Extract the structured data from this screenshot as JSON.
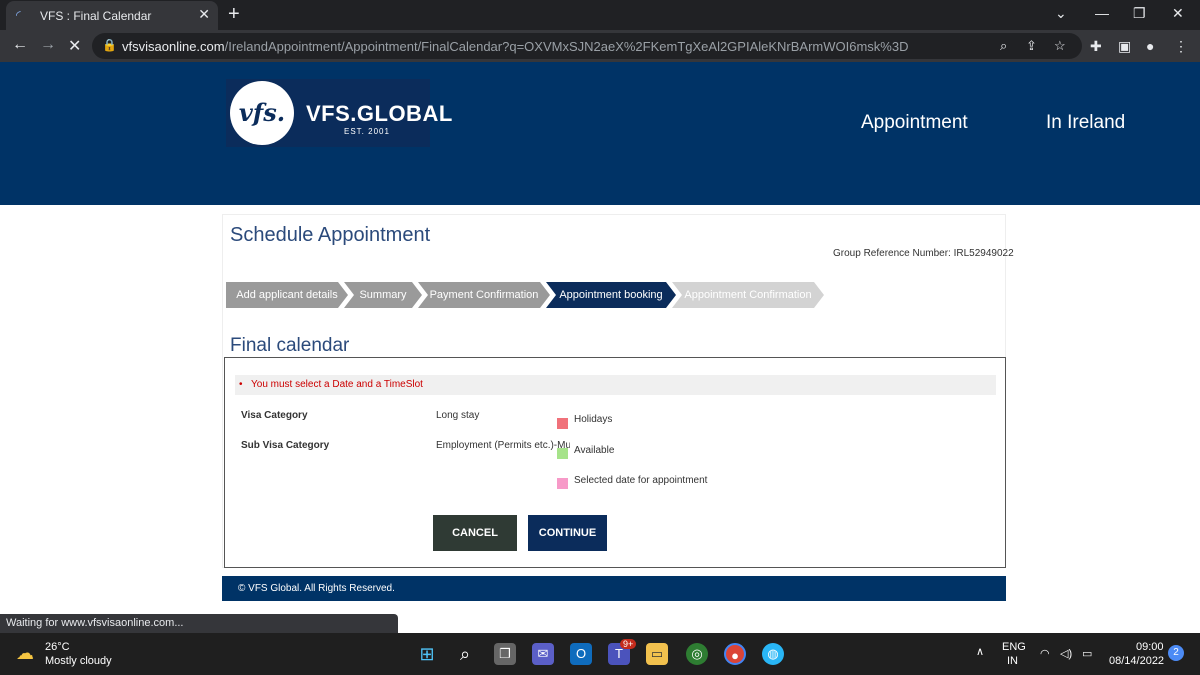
{
  "browser": {
    "tab_title": "VFS : Final Calendar",
    "url_host": "vfsvisaonline.com",
    "url_path": "/IrelandAppointment/Appointment/FinalCalendar?q=OXVMxSJN2aeX%2FKemTgXeAl2GPIAleKNrBArmWOI6msk%3D",
    "status_text": "Waiting for www.vfsvisaonline.com..."
  },
  "header": {
    "logo_mark": "vfs.",
    "logo_name": "VFS.GLOBAL",
    "logo_est": "EST. 2001",
    "nav": [
      "Appointment",
      "In Ireland"
    ],
    "bg_color": "#003366"
  },
  "page": {
    "title": "Schedule Appointment",
    "group_ref": "Group Reference Number: IRL52949022",
    "steps": [
      {
        "label": "Add applicant details",
        "state": "done"
      },
      {
        "label": "Summary",
        "state": "done"
      },
      {
        "label": "Payment Confirmation",
        "state": "done"
      },
      {
        "label": "Appointment booking",
        "state": "active"
      },
      {
        "label": "Appointment Confirmation",
        "state": "pending"
      }
    ],
    "section_title": "Final calendar",
    "error": "You must select a Date and a TimeSlot",
    "visa_category_label": "Visa Category",
    "visa_category_value": "Long stay",
    "sub_visa_label": "Sub Visa Category",
    "sub_visa_value": "Employment (Permits etc.)-Multi",
    "legend": [
      {
        "label": "Holidays",
        "color": "#f0717a"
      },
      {
        "label": "Available",
        "color": "#a6e38a"
      },
      {
        "label": "Selected date for appointment",
        "color": "#f79ac8"
      }
    ],
    "cancel_label": "CANCEL",
    "continue_label": "CONTINUE",
    "footer": "© VFS Global. All Rights Reserved."
  },
  "taskbar": {
    "weather_temp": "26°C",
    "weather_desc": "Mostly cloudy",
    "lang_top": "ENG",
    "lang_bottom": "IN",
    "time": "09:00",
    "date": "08/14/2022",
    "notif_count": "2",
    "teams_badge": "9+"
  }
}
